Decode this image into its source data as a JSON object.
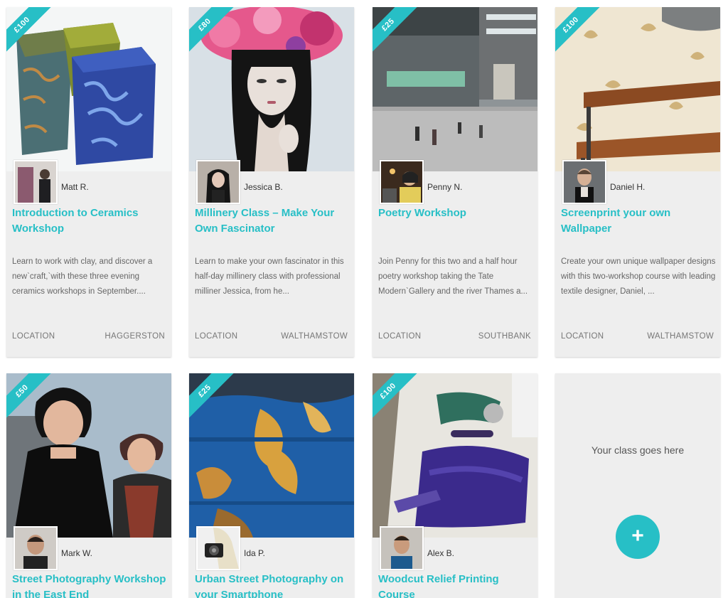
{
  "classes": [
    {
      "price": "£100",
      "host": "Matt R.",
      "title": "Introduction to Ceramics Workshop",
      "description": "Learn to work with clay, and discover a new`craft,`with these three evening ceramics workshops in September....",
      "location_label": "LOCATION",
      "location": "HAGGERSTON",
      "image": "ceramic-cubes-photo"
    },
    {
      "price": "£80",
      "host": "Jessica B.",
      "title": "Millinery Class – Make Your Own Fascinator",
      "description": "Learn to make your own fascinator in this half-day millinery class with professional milliner Jessica, from he...",
      "location_label": "LOCATION",
      "location": "WALTHAMSTOW",
      "image": "flower-headdress-portrait-photo"
    },
    {
      "price": "£25",
      "host": "Penny N.",
      "title": "Poetry Workshop",
      "description": "Join Penny for this two and a half hour poetry workshop taking the Tate Modern`Gallery and the river Thames a...",
      "location_label": "LOCATION",
      "location": "SOUTHBANK",
      "image": "turbine-hall-photo"
    },
    {
      "price": "£100",
      "host": "Daniel H.",
      "title": "Screenprint your own Wallpaper",
      "description": "Create your own unique wallpaper designs with this two-workshop course with leading textile designer, Daniel, ...",
      "location_label": "LOCATION",
      "location": "WALTHAMSTOW",
      "image": "wallpaper-bench-photo"
    },
    {
      "price": "£50",
      "host": "Mark W.",
      "title": "Street Photography Workshop in the East End",
      "image": "street-portrait-photo"
    },
    {
      "price": "£25",
      "host": "Ida P.",
      "title": "Urban Street Photography on your Smartphone",
      "image": "peeling-blue-paint-photo"
    },
    {
      "price": "£100",
      "host": "Alex B.",
      "title": "Woodcut Relief Printing Course",
      "image": "purple-ink-print-table-photo"
    }
  ],
  "placeholder": {
    "text": "Your class goes here",
    "button_icon": "plus-icon",
    "button_symbol": "+"
  },
  "colors": {
    "accent": "#27bfc6",
    "card_bg": "#eeeeee"
  }
}
